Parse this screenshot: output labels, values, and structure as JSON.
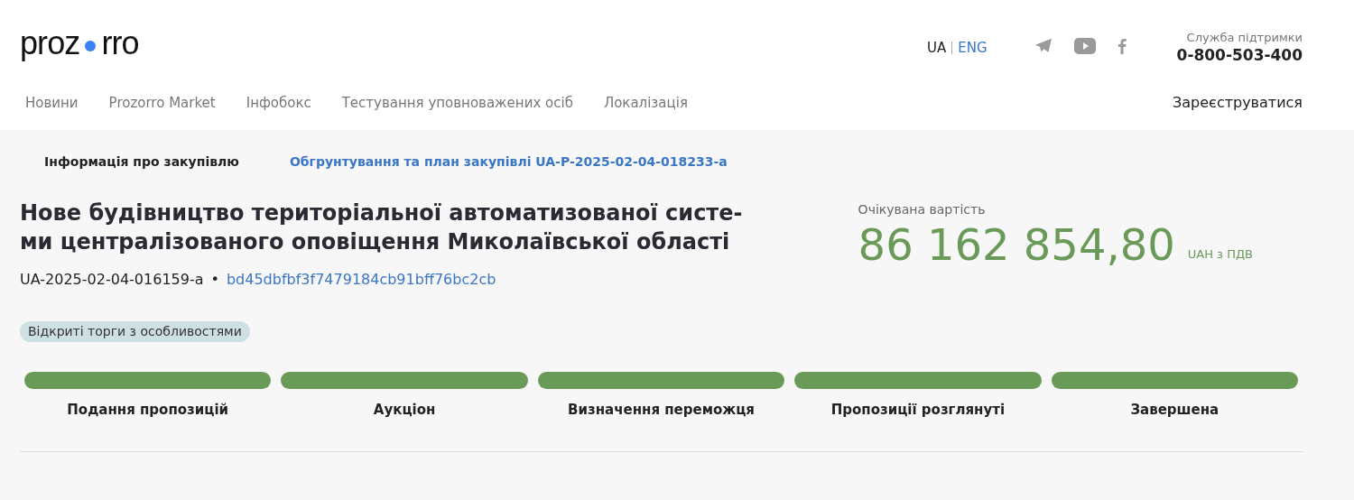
{
  "logo": {
    "left": "proz",
    "right": "rro"
  },
  "languages": [
    {
      "label": "UA",
      "selected": true
    },
    {
      "label": "ENG",
      "selected": false
    }
  ],
  "socials": [
    {
      "kind": "telegram"
    },
    {
      "kind": "youtube"
    },
    {
      "kind": "facebook"
    }
  ],
  "support": {
    "label": "Служба підтримки",
    "phone": "0-800-503-400"
  },
  "nav": [
    "Новини",
    "Prozorro Market",
    "Інфобокс",
    "Тестування уповноважених осіб",
    "Локалізація"
  ],
  "register": "Зареєструватися",
  "tabs": [
    {
      "label": "Інформація про закупівлю",
      "selected": true
    },
    {
      "label": "Обгрунтування та план закупівлі UA-P-2025-02-04-018233-a",
      "selected": false
    }
  ],
  "title_lines": [
    "Нове будівництво територіальної автоматизованої систе-",
    "ми централізованого оповіщення Миколаївської області"
  ],
  "tender_id": "UA-2025-02-04-016159-a",
  "separator": "•",
  "hash": "bd45dbfbf3f7479184cb91bff76bc2cb",
  "procedure": "Відкриті торги з особливостями",
  "value": {
    "label": "Очікувана вартість",
    "amount": "86 162 854,80",
    "currency": "UAH з ПДВ"
  },
  "stages": [
    {
      "label": "Подання пропозицій",
      "done": true
    },
    {
      "label": "Аукціон",
      "done": true
    },
    {
      "label": "Визначення переможця",
      "done": true
    },
    {
      "label": "Пропозиції розглянуті",
      "done": true
    },
    {
      "label": "Завершена",
      "done": true
    }
  ]
}
